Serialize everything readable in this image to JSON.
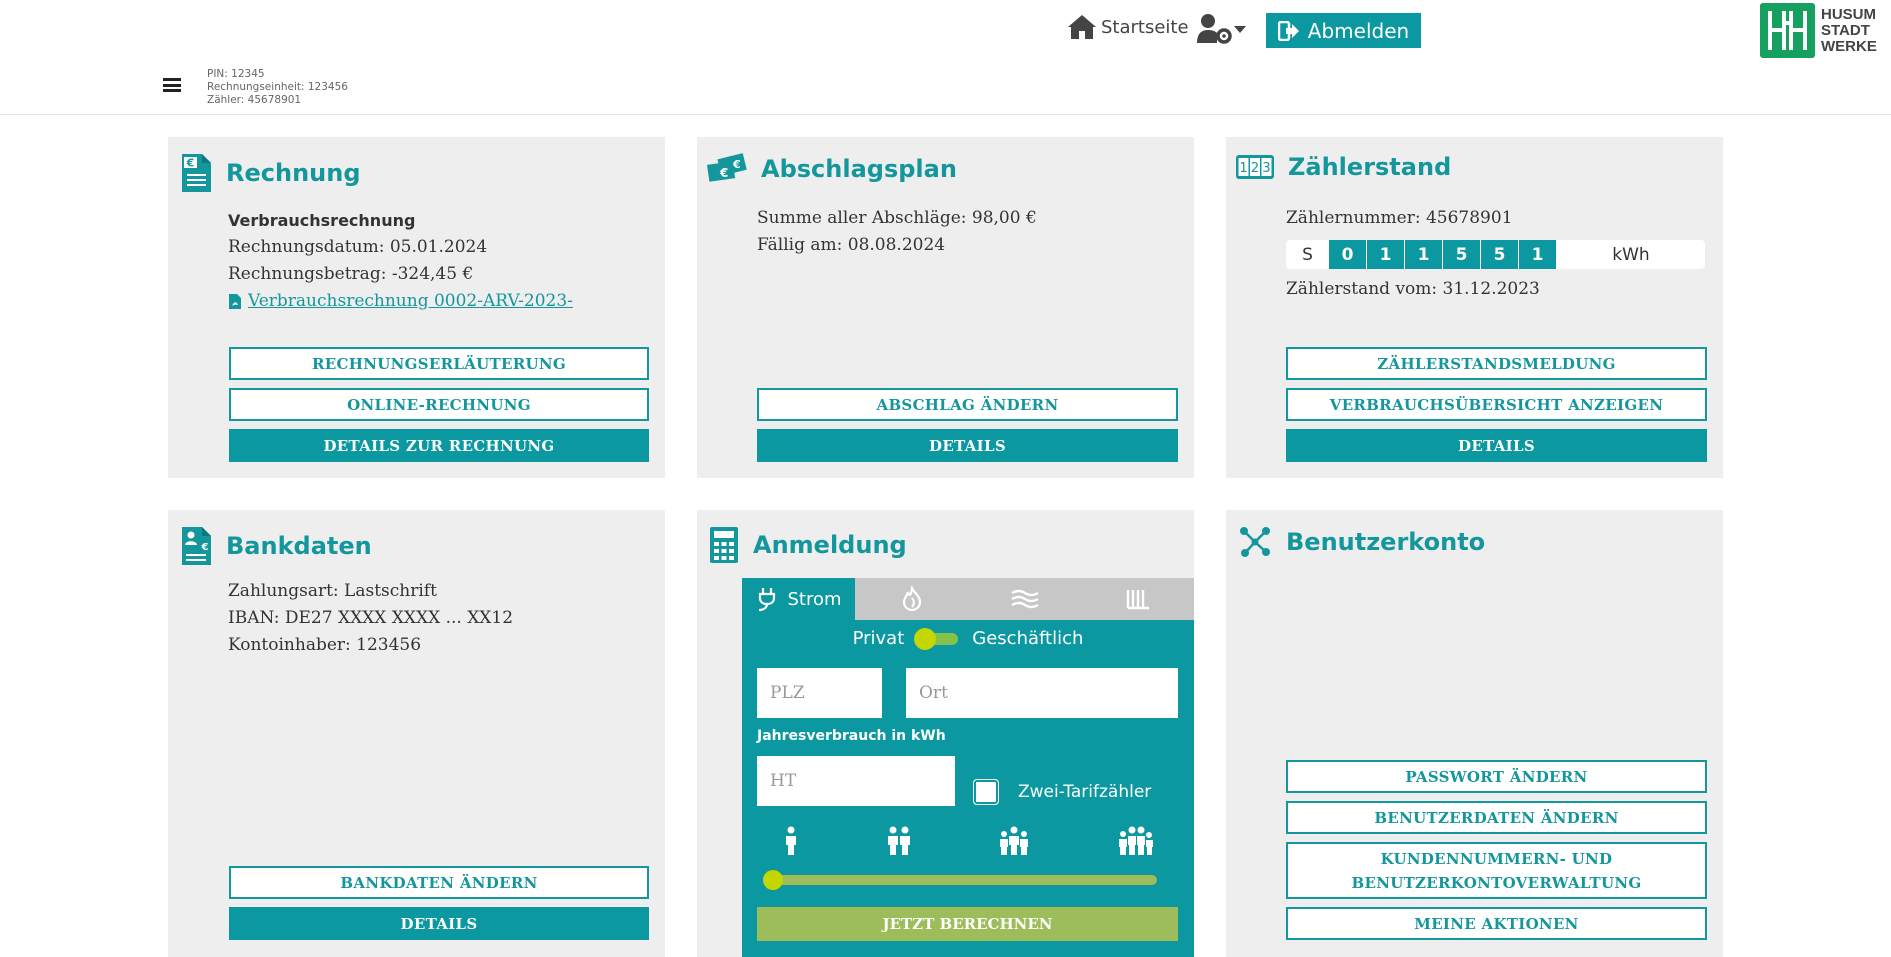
{
  "header": {
    "home_label": "Startseite",
    "logout_label": "Abmelden",
    "meta": {
      "pin": "PIN: 12345",
      "rechnungseinheit": "Rechnungseinheit: 123456",
      "zaehler": "Zähler: 45678901"
    },
    "logo": {
      "line1": "HUSUM",
      "line2": "STADT",
      "line3": "WERKE"
    }
  },
  "colors": {
    "accent": "#0b98a0",
    "title": "#14969d",
    "card_bg": "#eeeeee",
    "green": "#9cbd5a",
    "knob": "#c6d600"
  },
  "rechnung": {
    "title": "Rechnung",
    "type": "Verbrauchsrechnung",
    "datum": "Rechnungsdatum: 05.01.2024",
    "betrag": "Rechnungsbetrag: -324,45 €",
    "pdf_link": "Verbrauchsrechnung 0002-ARV-2023-",
    "btn_erlaeuterung": "RECHNUNGSERLÄUTERUNG",
    "btn_online": "ONLINE-RECHNUNG",
    "btn_details": "DETAILS ZUR RECHNUNG"
  },
  "abschlag": {
    "title": "Abschlagsplan",
    "summe": "Summe aller Abschläge: 98,00 €",
    "faellig": "Fällig am: 08.08.2024",
    "btn_aendern": "ABSCHLAG ÄNDERN",
    "btn_details": "DETAILS"
  },
  "zaehlerstand": {
    "title": "Zählerstand",
    "icon_text": "123",
    "nummer": "Zählernummer: 45678901",
    "meter_prefix": "S",
    "digits": [
      "0",
      "1",
      "1",
      "5",
      "5",
      "1"
    ],
    "unit": "kWh",
    "stand_vom": "Zählerstand vom: 31.12.2023",
    "btn_meldung": "ZÄHLERSTANDSMELDUNG",
    "btn_uebersicht": "VERBRAUCHSÜBERSICHT ANZEIGEN",
    "btn_details": "DETAILS"
  },
  "bankdaten": {
    "title": "Bankdaten",
    "zahlungsart": "Zahlungsart: Lastschrift",
    "iban": "IBAN: DE27 XXXX XXXX ... XX12",
    "inhaber": "Kontoinhaber: 123456",
    "btn_aendern": "BANKDATEN ÄNDERN",
    "btn_details": "DETAILS"
  },
  "anmeldung": {
    "title": "Anmeldung",
    "tabs": [
      {
        "label": "Strom",
        "icon": "plug-icon",
        "active": true
      },
      {
        "label": "",
        "icon": "gas-flame-icon",
        "active": false
      },
      {
        "label": "",
        "icon": "water-waves-icon",
        "active": false
      },
      {
        "label": "",
        "icon": "heating-icon",
        "active": false
      }
    ],
    "privat": "Privat",
    "geschaeftlich": "Geschäftlich",
    "plz_placeholder": "PLZ",
    "ort_placeholder": "Ort",
    "jahresverbrauch_label": "Jahresverbrauch in kWh",
    "ht_placeholder": "HT",
    "zwei_tarif": "Zwei-Tarifzähler",
    "persons": [
      1,
      2,
      3,
      4
    ],
    "slider_value": 0,
    "btn_berechnen": "JETZT BERECHNEN"
  },
  "benutzerkonto": {
    "title": "Benutzerkonto",
    "btn_passwort": "PASSWORT ÄNDERN",
    "btn_benutzerdaten": "BENUTZERDATEN ÄNDERN",
    "btn_kundennummern_line1": "KUNDENNUMMERN- UND",
    "btn_kundennummern_line2": "BENUTZERKONTOVERWALTUNG",
    "btn_aktionen": "MEINE AKTIONEN"
  }
}
